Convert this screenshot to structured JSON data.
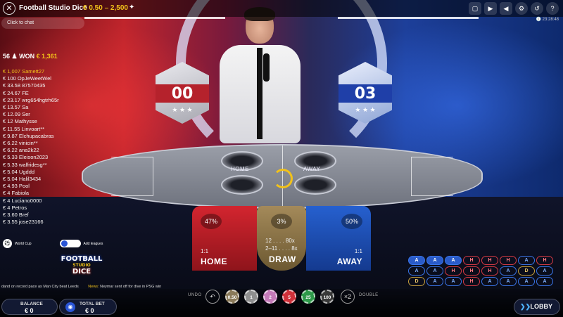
{
  "header": {
    "title": "Football Studio Dice",
    "limits": "€ 0.50 – 2,500",
    "close_icon": "✕",
    "pin_icon": "✦",
    "clock": "🕔 23:28:48",
    "icons": [
      "chat-icon",
      "camera-icon",
      "volume-icon",
      "settings-icon",
      "history-icon",
      "help-icon"
    ],
    "icon_glyphs": [
      "▢",
      "▶",
      "◀",
      "⚙",
      "↺",
      "?"
    ]
  },
  "chat": {
    "placeholder": "Click to chat"
  },
  "winners": {
    "count": "56",
    "won_label": "WON",
    "won_amount": "€ 1,361",
    "list": [
      "€ 1,007 Samett27",
      "€ 100 OpJeWeetWel",
      "€ 33.58 87570435",
      "€ 24.67 FE",
      "€ 23.17 wrg654hgtrh65r",
      "€ 13.57 Sa",
      "€ 12.09 Ser",
      "€ 12 Mathysse",
      "€ 11.55 Linvoart**",
      "€ 9.87 Elchupacabras",
      "€ 6.22 vinicin**",
      "€ 6.22 ana2k22",
      "€ 5.33 Eleison2023",
      "€ 5.33 walfridesg**",
      "€ 5.04 Ugddd",
      "€ 5.04 Halil3434",
      "€ 4.93 Pool",
      "€ 4 Fabiola",
      "€ 4 Luciano0000",
      "€ 4 Petros",
      "€ 3.60 Bref",
      "€ 3.55 jose23166"
    ]
  },
  "leagues": {
    "world_cup": "World Cup",
    "add_leagues": "Add leagues",
    "add_icon": "+"
  },
  "logo": {
    "line1": "FOOTBALL",
    "line2": "STUDIO",
    "line3": "DICE"
  },
  "ticker": {
    "text": "dand on record pace as Man City beat Leeds",
    "news_label": "News:",
    "news": "Neymar sent off for dive in PSG win"
  },
  "scores": {
    "home": "00",
    "away": "03"
  },
  "table_labels": {
    "home": "HOME",
    "away": "AWAY"
  },
  "bets": {
    "home": {
      "pct": "47%",
      "odds": "1:1",
      "name": "HOME"
    },
    "draw": {
      "pct": "3%",
      "odds1": "12 . . . . 80x",
      "odds2": "2–11 . . . . 8x",
      "name": "DRAW"
    },
    "away": {
      "pct": "50%",
      "odds": "1:1",
      "name": "AWAY"
    }
  },
  "road": [
    [
      "A",
      "A",
      "A",
      "H",
      "H",
      "H",
      "A",
      "H"
    ],
    [
      "A",
      "A",
      "H",
      "H",
      "H",
      "A",
      "D",
      "A"
    ],
    [
      "D",
      "A",
      "A",
      "H",
      "A",
      "A",
      "A",
      "A"
    ]
  ],
  "controls": {
    "undo": "UNDO",
    "double": "DOUBLE",
    "undo_icon": "↶",
    "double_icon": "×2",
    "chips": [
      {
        "label": "0.50",
        "color": "#8a7a5a"
      },
      {
        "label": "1",
        "color": "#8f8f8f"
      },
      {
        "label": "2",
        "color": "#c47ab8"
      },
      {
        "label": "5",
        "color": "#d0313a"
      },
      {
        "label": "25",
        "color": "#2e9a4a"
      },
      {
        "label": "100",
        "color": "#3a3a3a"
      }
    ]
  },
  "balance": {
    "label": "BALANCE",
    "value": "€ 0"
  },
  "total_bet": {
    "label": "TOTAL BET",
    "value": "€ 0"
  },
  "lobby": {
    "label": "LOBBY",
    "icon": "❯❯"
  },
  "colors": {
    "home": "#d3252f",
    "away": "#2660cf",
    "draw": "#a48a5a",
    "accent": "#f2c21a"
  }
}
